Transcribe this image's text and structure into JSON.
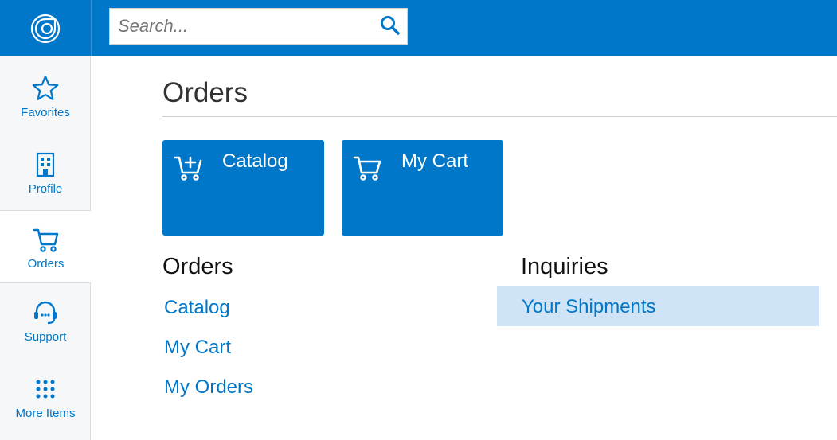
{
  "colors": {
    "brand": "#0077c8",
    "highlight": "#cfe4f6"
  },
  "logo": {
    "icon": "acumatica-logo-icon"
  },
  "search": {
    "placeholder": "Search...",
    "value": "",
    "icon": "search-icon"
  },
  "sidebar": {
    "items": [
      {
        "label": "Favorites",
        "icon": "star-icon",
        "active": false
      },
      {
        "label": "Profile",
        "icon": "building-icon",
        "active": false
      },
      {
        "label": "Orders",
        "icon": "cart-icon",
        "active": true
      },
      {
        "label": "Support",
        "icon": "headset-icon",
        "active": false
      },
      {
        "label": "More Items",
        "icon": "grid-dots-icon",
        "active": false
      }
    ]
  },
  "main": {
    "title": "Orders",
    "tiles": [
      {
        "label": "Catalog",
        "icon": "cart-plus-icon"
      },
      {
        "label": "My Cart",
        "icon": "cart-icon"
      }
    ],
    "sections": [
      {
        "title": "Orders",
        "links": [
          "Catalog",
          "My Cart",
          "My Orders"
        ]
      },
      {
        "title": "Inquiries",
        "links": [
          "Your Shipments"
        ]
      }
    ]
  }
}
